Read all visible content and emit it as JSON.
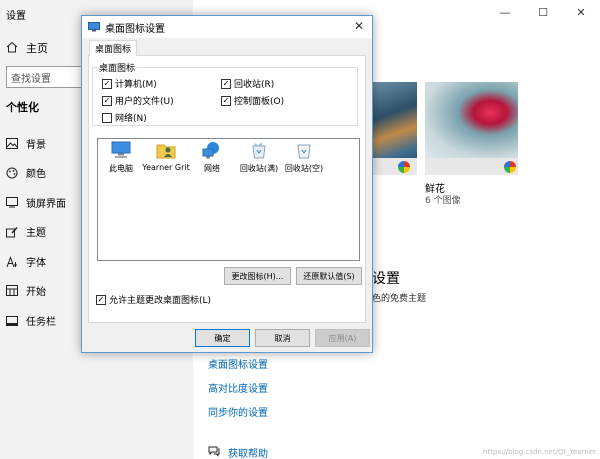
{
  "settings": {
    "app_title": "设置",
    "home": "主页",
    "search_placeholder": "查找设置",
    "section_heading": "个性化",
    "nav": [
      {
        "label": "背景",
        "icon": "image-icon"
      },
      {
        "label": "颜色",
        "icon": "palette-icon"
      },
      {
        "label": "锁屏界面",
        "icon": "lock-screen-icon"
      },
      {
        "label": "主题",
        "icon": "brush-icon"
      },
      {
        "label": "字体",
        "icon": "font-icon"
      },
      {
        "label": "开始",
        "icon": "start-grid-icon"
      },
      {
        "label": "任务栏",
        "icon": "taskbar-icon"
      }
    ],
    "window_controls": {
      "minimize": "—",
      "maximize": "☐",
      "close": "✕"
    },
    "themes": {
      "theme2_name": "鲜花",
      "theme2_count": "6 个图像"
    },
    "partial_heading": "设置",
    "partial_sub": "色的免费主题",
    "links": [
      "桌面图标设置",
      "高对比度设置",
      "同步你的设置"
    ],
    "help": "获取帮助",
    "watermark": "https://blog.csdn.net/Qt_Yearner"
  },
  "dialog": {
    "title": "桌面图标设置",
    "close": "✕",
    "tab": "桌面图标",
    "group_title": "桌面图标",
    "checkboxes": [
      {
        "label": "计算机(M)",
        "checked": "✓"
      },
      {
        "label": "回收站(R)",
        "checked": "✓"
      },
      {
        "label": "用户的文件(U)",
        "checked": "✓"
      },
      {
        "label": "控制面板(O)",
        "checked": "✓"
      },
      {
        "label": "网络(N)",
        "checked": ""
      }
    ],
    "icons": [
      {
        "label": "此电脑",
        "icon": "computer-icon"
      },
      {
        "label": "Yearner Grit",
        "icon": "user-folder-icon"
      },
      {
        "label": "网络",
        "icon": "network-icon"
      },
      {
        "label": "回收站(满)",
        "icon": "recycle-bin-full-icon"
      },
      {
        "label": "回收站(空)",
        "icon": "recycle-bin-empty-icon"
      }
    ],
    "change_icon_button": "更改图标(H)...",
    "restore_default_button": "还原默认值(S)",
    "allow_themes": {
      "label": "允许主题更改桌面图标(L)",
      "checked": "✓"
    },
    "ok": "确定",
    "cancel": "取消",
    "apply": "应用(A)"
  }
}
